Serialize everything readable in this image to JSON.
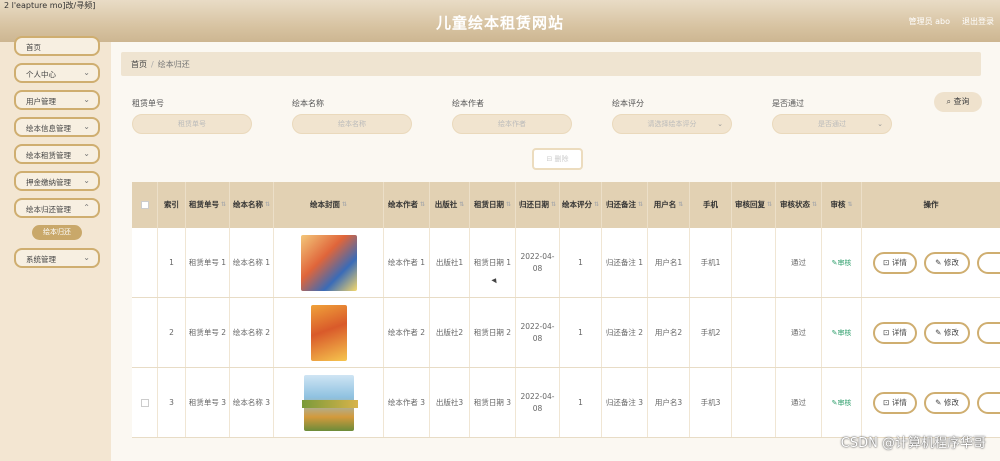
{
  "window_label": "2 l'eapture mo]改/寻频]",
  "header": {
    "site_title": "儿童绘本租赁网站",
    "user": "管理员 abo",
    "logout": "退出登录"
  },
  "sidebar": {
    "items": [
      {
        "label": "首页"
      },
      {
        "label": "个人中心"
      },
      {
        "label": "用户管理"
      },
      {
        "label": "绘本信息管理"
      },
      {
        "label": "绘本租赁管理"
      },
      {
        "label": "押金缴纳管理"
      },
      {
        "label": "绘本归还管理"
      },
      {
        "label": "系统管理"
      }
    ],
    "active_sub": "绘本归还"
  },
  "breadcrumb": {
    "home": "首页",
    "separator": "/",
    "current": "绘本归还"
  },
  "filters": [
    {
      "label": "租赁单号",
      "placeholder": "租赁单号"
    },
    {
      "label": "绘本名称",
      "placeholder": "绘本名称"
    },
    {
      "label": "绘本作者",
      "placeholder": "绘本作者"
    },
    {
      "label": "绘本评分",
      "placeholder": "请选择绘本评分"
    },
    {
      "label": "是否通过",
      "placeholder": "是否通过"
    }
  ],
  "buttons": {
    "search": "查询",
    "delete": "删除"
  },
  "table": {
    "headers": [
      "索引",
      "租赁单号",
      "绘本名称",
      "绘本封面",
      "绘本作者",
      "出版社",
      "租赁日期",
      "归还日期",
      "绘本评分",
      "归还备注",
      "用户名",
      "手机",
      "审核回复",
      "审核状态",
      "审核",
      "操作"
    ],
    "rows": [
      {
        "index": "1",
        "rent_no": "租赁单号 1",
        "name": "绘本名称 1",
        "author": "绘本作者 1",
        "publisher": "出版社1",
        "rent_date": "租赁日期 1",
        "return_date": "2022-04-08",
        "score": "1",
        "remark": "归还备注 1",
        "username": "用户名1",
        "phone": "手机1",
        "reply": "",
        "status": "通过",
        "audit": "审核"
      },
      {
        "index": "2",
        "rent_no": "租赁单号 2",
        "name": "绘本名称 2",
        "author": "绘本作者 2",
        "publisher": "出版社2",
        "rent_date": "租赁日期 2",
        "return_date": "2022-04-08",
        "score": "1",
        "remark": "归还备注 2",
        "username": "用户名2",
        "phone": "手机2",
        "reply": "",
        "status": "通过",
        "audit": "审核"
      },
      {
        "index": "3",
        "rent_no": "租赁单号 3",
        "name": "绘本名称 3",
        "author": "绘本作者 3",
        "publisher": "出版社3",
        "rent_date": "租赁日期 3",
        "return_date": "2022-04-08",
        "score": "1",
        "remark": "归还备注 3",
        "username": "用户名3",
        "phone": "手机3",
        "reply": "",
        "status": "通过",
        "audit": "审核"
      }
    ],
    "actions": {
      "detail": "详情",
      "edit": "修改"
    }
  },
  "watermark": "CSDN @计算机程序华哥",
  "colors": {
    "accent": "#c9a86a",
    "header_bg": "#d8c4a3",
    "table_header": "#e2d1b3",
    "audit_green": "#2e9e6b"
  }
}
